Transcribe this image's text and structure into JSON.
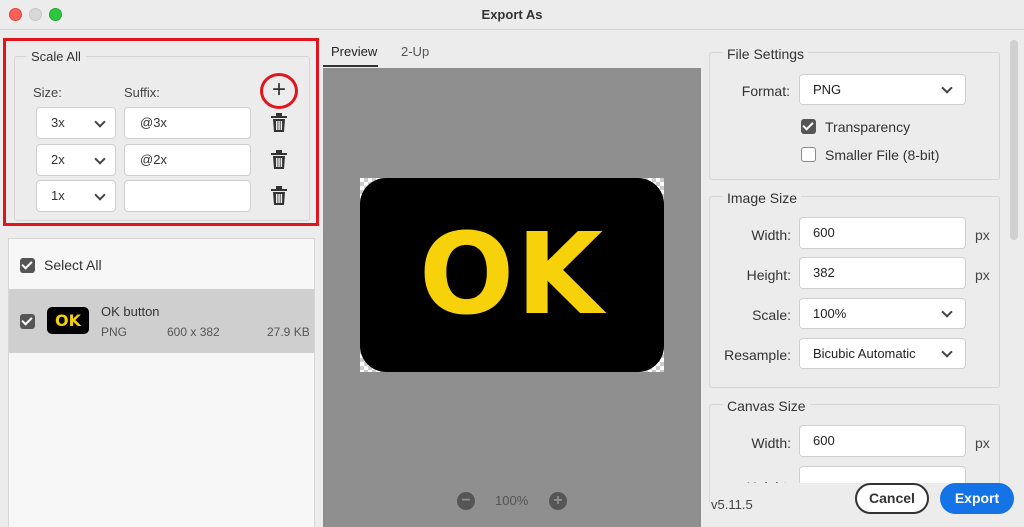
{
  "window": {
    "title": "Export As"
  },
  "scale_all": {
    "legend": "Scale All",
    "size_label": "Size:",
    "suffix_label": "Suffix:",
    "add_label": "+",
    "rows": [
      {
        "size": "3x",
        "suffix": "@3x"
      },
      {
        "size": "2x",
        "suffix": "@2x"
      },
      {
        "size": "1x",
        "suffix": ""
      }
    ]
  },
  "assets": {
    "select_all_label": "Select All",
    "items": [
      {
        "thumb_text": "OK",
        "name": "OK button",
        "format": "PNG",
        "dimensions": "600 x 382",
        "size": "27.9 KB"
      }
    ]
  },
  "preview": {
    "tabs": [
      "Preview",
      "2-Up"
    ],
    "image_text": "OK",
    "zoom": "100%",
    "zoom_out": "−",
    "zoom_in": "+"
  },
  "file_settings": {
    "legend": "File Settings",
    "format_label": "Format:",
    "format_value": "PNG",
    "transparency_label": "Transparency",
    "transparency_checked": true,
    "smaller_file_label": "Smaller File (8-bit)",
    "smaller_file_checked": false
  },
  "image_size": {
    "legend": "Image Size",
    "width_label": "Width:",
    "width_value": "600",
    "height_label": "Height:",
    "height_value": "382",
    "unit": "px",
    "scale_label": "Scale:",
    "scale_value": "100%",
    "resample_label": "Resample:",
    "resample_value": "Bicubic Automatic"
  },
  "canvas_size": {
    "legend": "Canvas Size",
    "width_label": "Width:",
    "width_value": "600",
    "height_label": "Height:",
    "unit": "px"
  },
  "footer": {
    "version": "v5.11.5",
    "cancel": "Cancel",
    "export": "Export"
  },
  "colors": {
    "highlight": "#e0161c",
    "accent": "#1473e6",
    "ok_yellow": "#f7d20a"
  }
}
